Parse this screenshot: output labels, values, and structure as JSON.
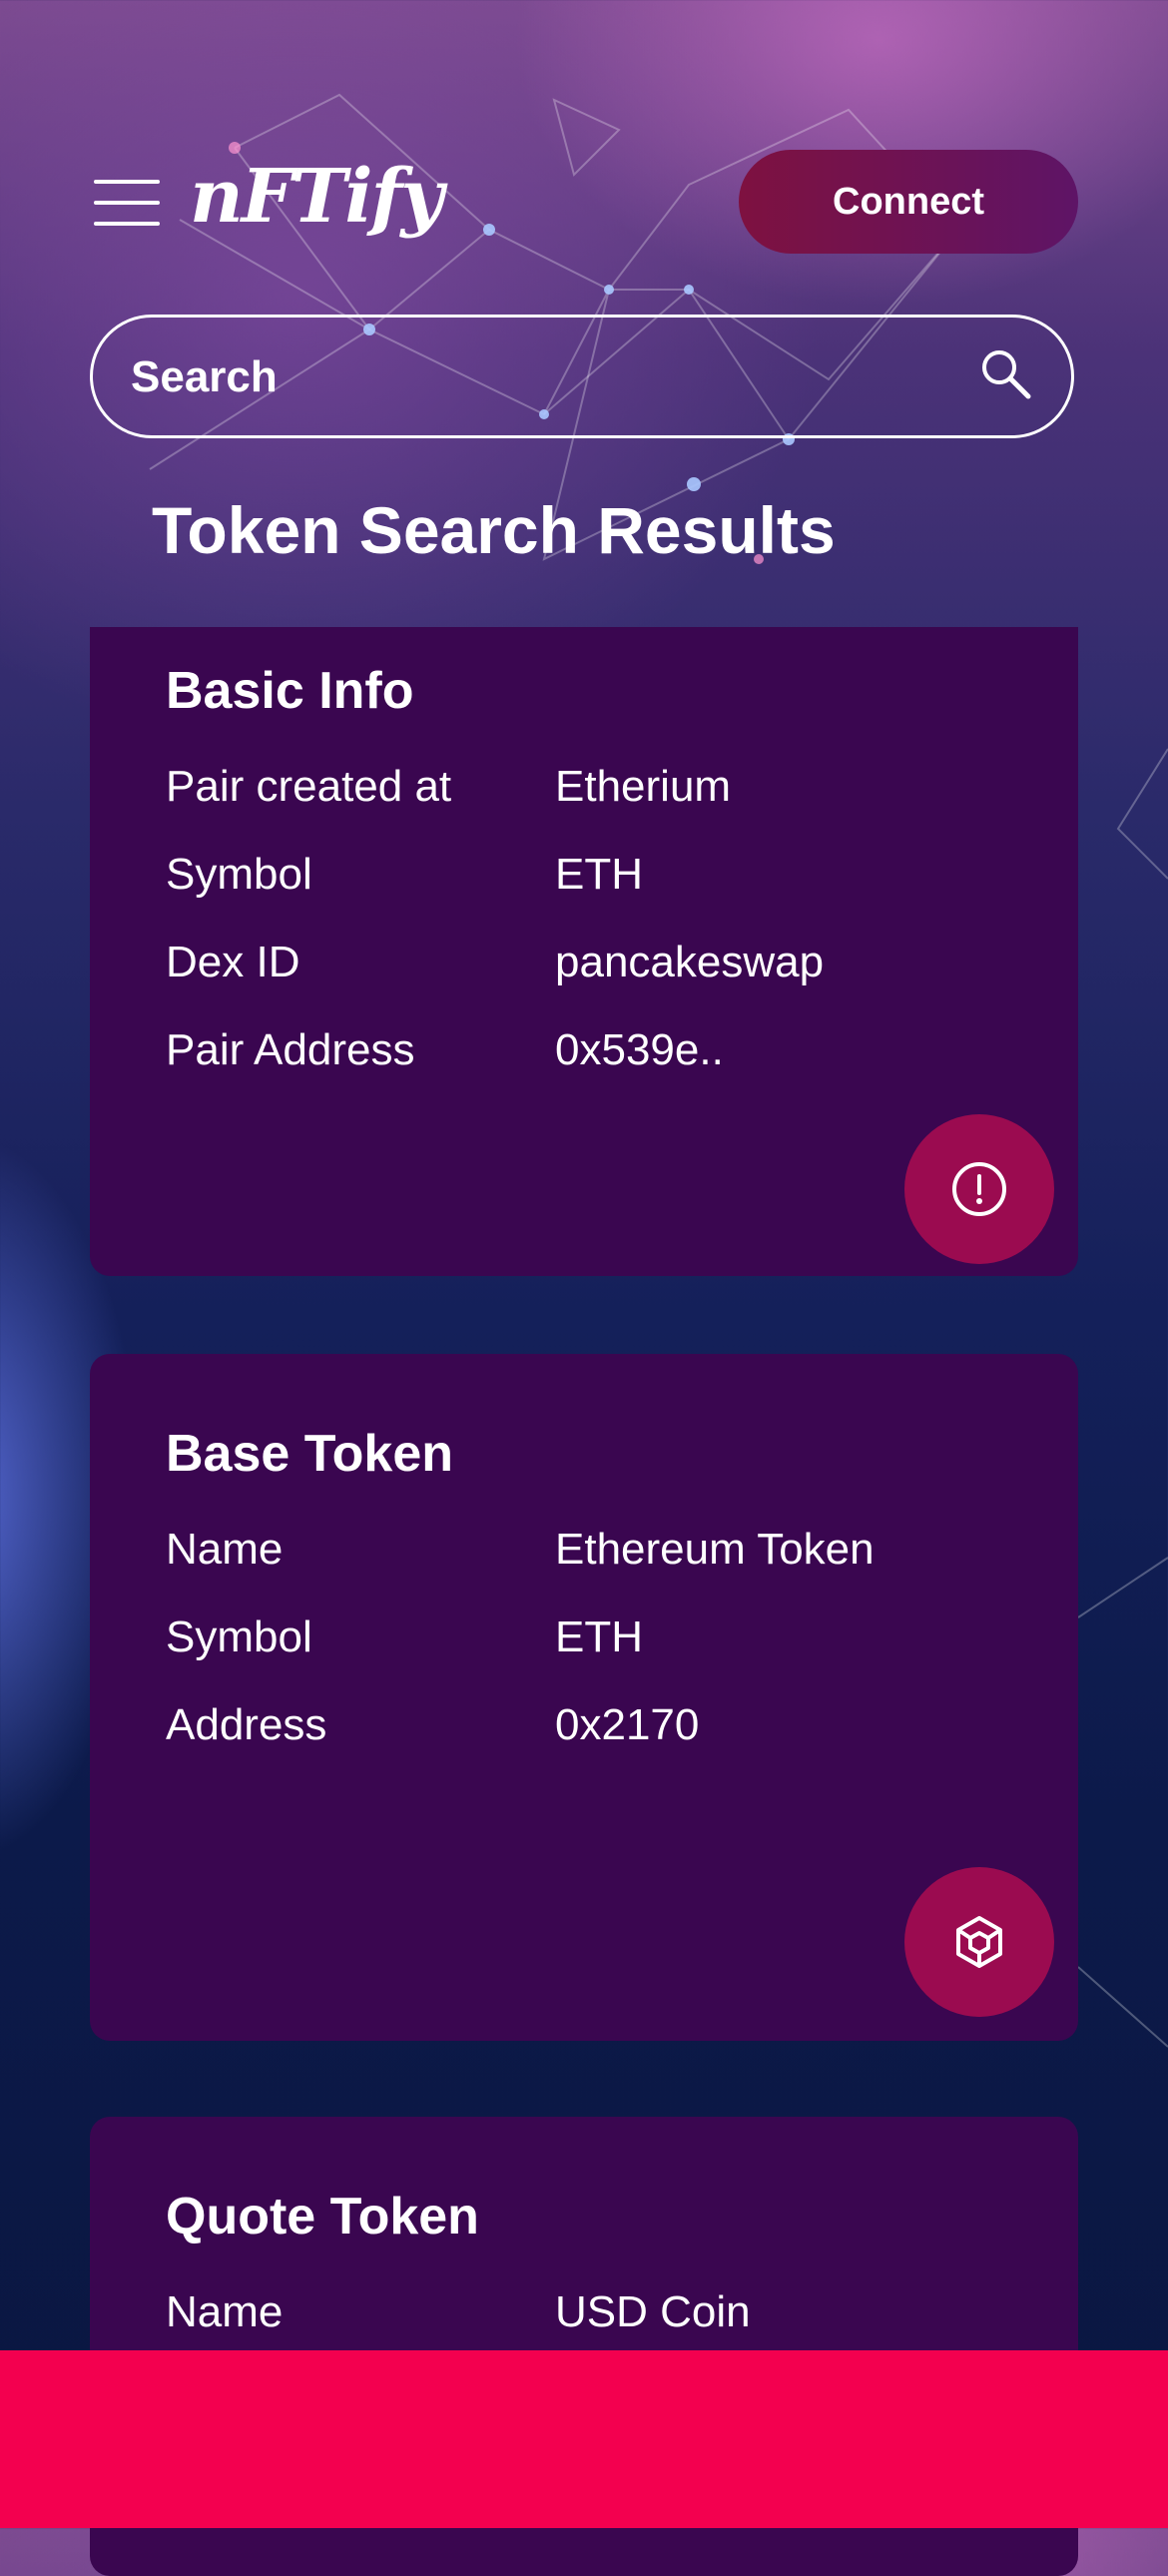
{
  "header": {
    "logo": "nFTify",
    "connect_label": "Connect"
  },
  "search": {
    "placeholder": "Search"
  },
  "page_title": "Token Search Results",
  "cards": {
    "basic": {
      "title": "Basic Info",
      "rows": [
        {
          "label": "Pair created at",
          "value": "Etherium"
        },
        {
          "label": "Symbol",
          "value": "ETH"
        },
        {
          "label": "Dex ID",
          "value": "pancakeswap"
        },
        {
          "label": "Pair Address",
          "value": "0x539e.."
        }
      ],
      "action_icon": "info-circle-icon"
    },
    "base": {
      "title": "Base Token",
      "rows": [
        {
          "label": "Name",
          "value": "Ethereum Token"
        },
        {
          "label": "Symbol",
          "value": "ETH"
        },
        {
          "label": "Address",
          "value": "0x2170"
        }
      ],
      "action_icon": "cube-icon"
    },
    "quote": {
      "title": "Quote Token",
      "rows": [
        {
          "label": "Name",
          "value": "USD Coin"
        }
      ]
    }
  },
  "colors": {
    "card": "#3a0650",
    "accent": "#9b0b50",
    "bottom_bar": "#f3004f"
  }
}
